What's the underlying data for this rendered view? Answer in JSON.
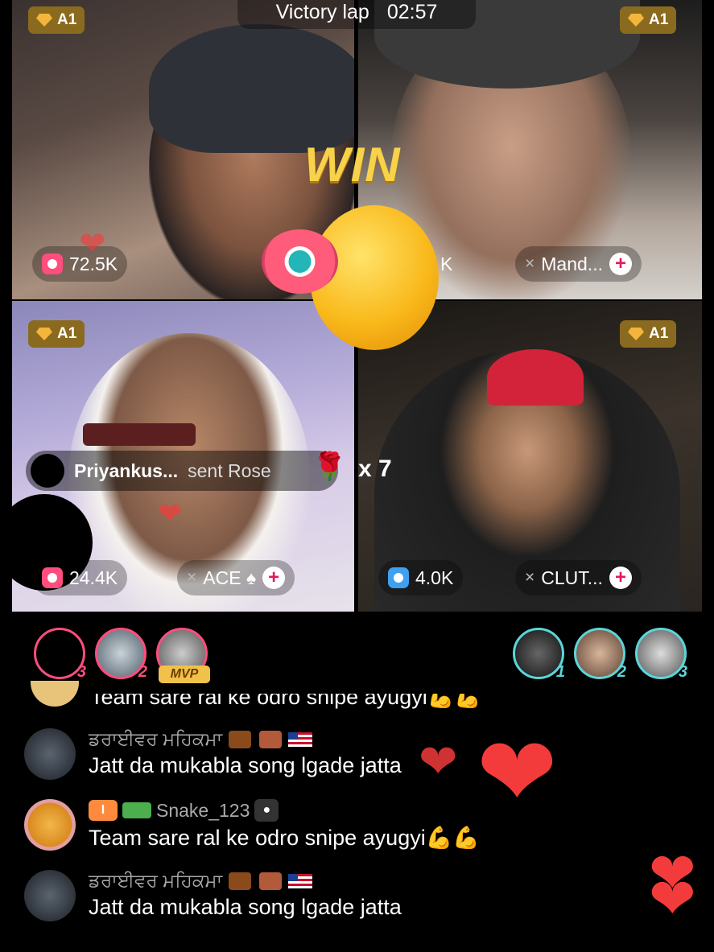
{
  "battle": {
    "title": "Victory lap",
    "time": "02:57",
    "win_label": "WIN"
  },
  "tiles": [
    {
      "tier": "A1",
      "score": "72.5K"
    },
    {
      "tier": "A1",
      "partial": "K",
      "name": "Mand...",
      "plus": "+"
    },
    {
      "tier": "A1",
      "score": "24.4K",
      "name": "ACE ♠",
      "plus": "+"
    },
    {
      "tier": "A1",
      "score": "4.0K",
      "name": "CLUT...",
      "plus": "+"
    }
  ],
  "mute_icon": "×",
  "gift": {
    "sender": "Priyankus...",
    "action": "sent Rose",
    "count": "x 7",
    "gift_icon": "rose-icon"
  },
  "rankings": {
    "left": [
      {
        "rank": "3"
      },
      {
        "rank": "2"
      },
      {
        "badge": "MVP"
      }
    ],
    "right": [
      {
        "rank": "1"
      },
      {
        "rank": "2"
      },
      {
        "rank": "3"
      }
    ]
  },
  "chat": {
    "partial_text": "Team sare ral ke odro snipe ayugyi💪💪",
    "messages": [
      {
        "name": "ਡਰਾਈਵਰ ਮਹਿਕਮਾ",
        "text": "Jatt da mukabla song lgade jatta"
      },
      {
        "name": "Snake_123",
        "text": "Team sare ral ke odro snipe ayugyi💪💪",
        "level": "I"
      },
      {
        "name": "ਡਰਾਈਵਰ ਮਹਿਕਮਾ",
        "text": "Jatt da mukabla song lgade jatta"
      }
    ]
  },
  "colors": {
    "accent_pink": "#ff4d7d",
    "accent_blue": "#5bd6d9",
    "win_gold": "#f7d24a",
    "heart_red": "#f43b3b"
  }
}
